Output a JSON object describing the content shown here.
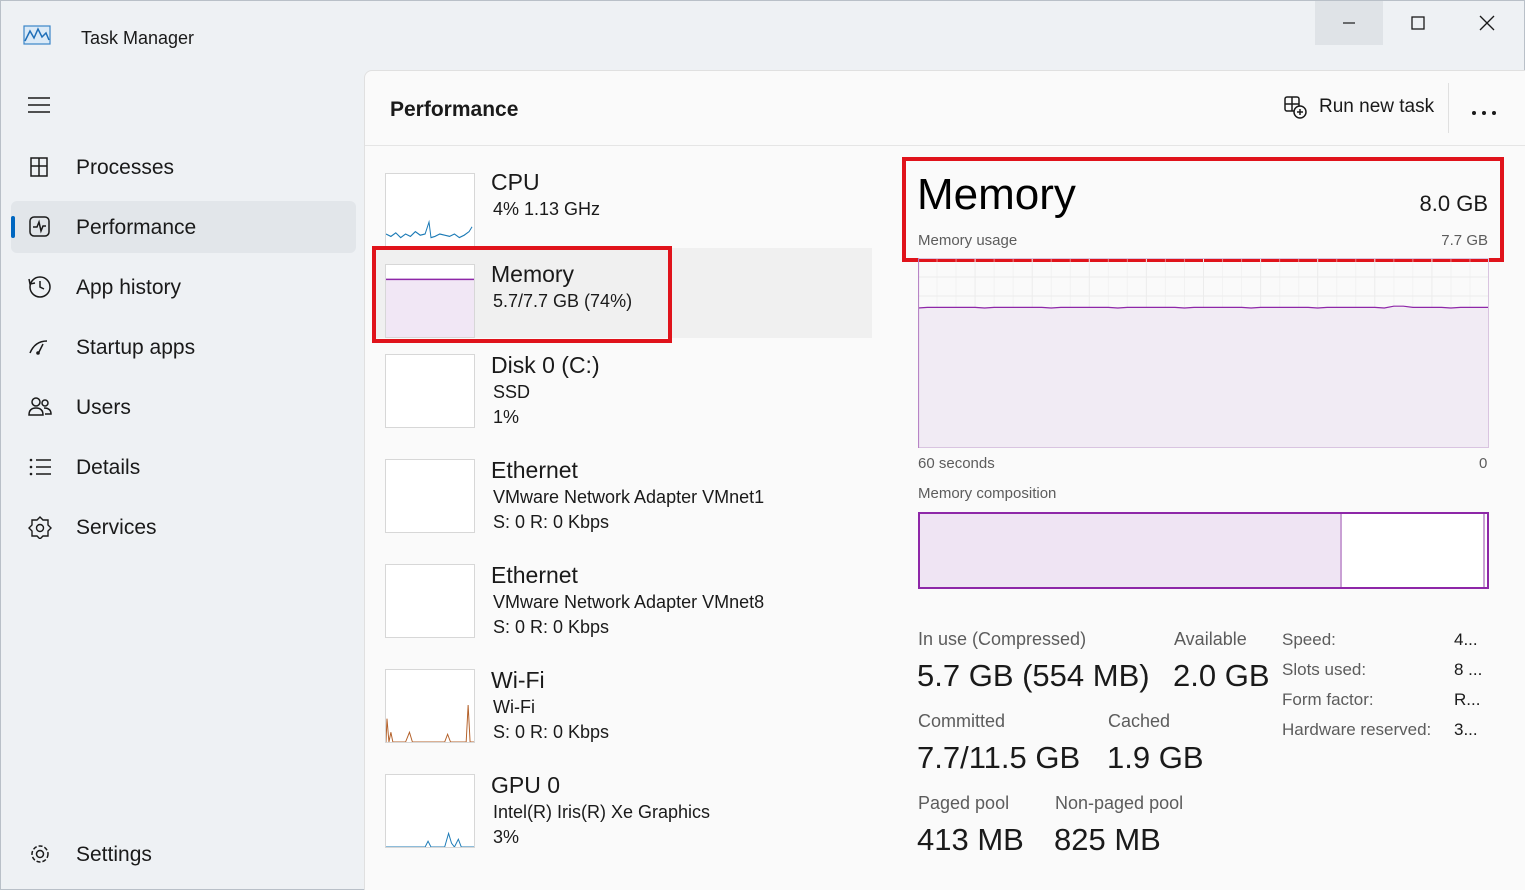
{
  "app": {
    "title": "Task Manager"
  },
  "sidebar": {
    "items": [
      {
        "label": "Processes",
        "icon": "processes-icon"
      },
      {
        "label": "Performance",
        "icon": "performance-icon",
        "active": true
      },
      {
        "label": "App history",
        "icon": "history-icon"
      },
      {
        "label": "Startup apps",
        "icon": "startup-icon"
      },
      {
        "label": "Users",
        "icon": "users-icon"
      },
      {
        "label": "Details",
        "icon": "details-icon"
      },
      {
        "label": "Services",
        "icon": "services-icon"
      }
    ],
    "settings_label": "Settings"
  },
  "header": {
    "title": "Performance",
    "run_task_label": "Run new task"
  },
  "devices": [
    {
      "name": "CPU",
      "line1": "4%  1.13 GHz",
      "line2": ""
    },
    {
      "name": "Memory",
      "line1": "5.7/7.7 GB (74%)",
      "line2": ""
    },
    {
      "name": "Disk 0 (C:)",
      "line1": "SSD",
      "line2": "1%"
    },
    {
      "name": "Ethernet",
      "line1": "VMware Network Adapter VMnet1",
      "line2": "S:  0  R:  0 Kbps"
    },
    {
      "name": "Ethernet",
      "line1": "VMware Network Adapter VMnet8",
      "line2": "S:  0  R:  0 Kbps"
    },
    {
      "name": "Wi-Fi",
      "line1": "Wi-Fi",
      "line2": "S:  0  R:  0 Kbps"
    },
    {
      "name": "GPU 0",
      "line1": "Intel(R) Iris(R) Xe Graphics",
      "line2": "3%"
    }
  ],
  "memory": {
    "title": "Memory",
    "total": "8.0 GB",
    "usage_label": "Memory usage",
    "usage_max": "7.7 GB",
    "axis_left": "60 seconds",
    "axis_right": "0",
    "composition_label": "Memory composition",
    "composition_in_use_fraction": 0.745,
    "composition_modified_fraction": 0.996,
    "graph_level_fraction": 0.74,
    "stats": {
      "in_use_label": "In use (Compressed)",
      "in_use_value": "5.7 GB (554 MB)",
      "available_label": "Available",
      "available_value": "2.0 GB",
      "committed_label": "Committed",
      "committed_value": "7.7/11.5 GB",
      "cached_label": "Cached",
      "cached_value": "1.9 GB",
      "paged_label": "Paged pool",
      "paged_value": "413 MB",
      "nonpaged_label": "Non-paged pool",
      "nonpaged_value": "825 MB"
    },
    "details": [
      {
        "label": "Speed:",
        "value": "4..."
      },
      {
        "label": "Slots used:",
        "value": "8 ..."
      },
      {
        "label": "Form factor:",
        "value": "R..."
      },
      {
        "label": "Hardware reserved:",
        "value": "3..."
      }
    ]
  },
  "colors": {
    "accent": "#0067c0",
    "memory": "#8e27a8",
    "highlight": "#e0131b",
    "cpu": "#1b7ab6",
    "wifi": "#b4612a"
  }
}
